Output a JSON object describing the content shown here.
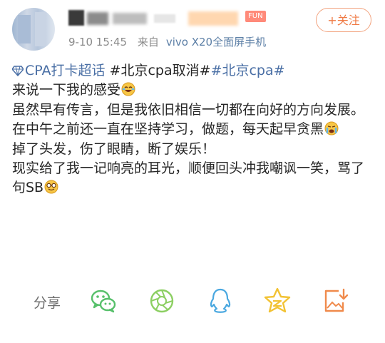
{
  "post": {
    "meta": {
      "time": "9-10 15:45",
      "source_prefix": "来自",
      "device": "vivo X20全面屏手机"
    },
    "badge": "FUN",
    "follow_label": "+关注",
    "topic_1": "CPA打卡超话",
    "topic_2": "#北京cpa取消#",
    "topic_3": "#北京cpa#",
    "lines": [
      "来说一下我的感受",
      "虽然早有传言，但是我依旧相信一切都在向好的方向发展。",
      "在中午之前还一直在坚持学习，做题，每天起早贪黑",
      "掉了头发，伤了眼睛，断了娱乐！",
      "现实给了我一记响亮的耳光，顺便回头冲我嘲讽一笑，骂了句SB"
    ]
  },
  "share": {
    "label": "分享",
    "icons": [
      "wechat-icon",
      "moments-icon",
      "qq-icon",
      "qzone-icon",
      "save-image-icon"
    ]
  },
  "colors": {
    "accent_orange": "#ef7a44",
    "link_blue": "#4a6fa5",
    "device_blue": "#5c7fa6",
    "share_green": "#57c06b",
    "share_blue": "#4aa8e0",
    "share_yellow": "#f2c233",
    "share_orange": "#f08a4b"
  }
}
